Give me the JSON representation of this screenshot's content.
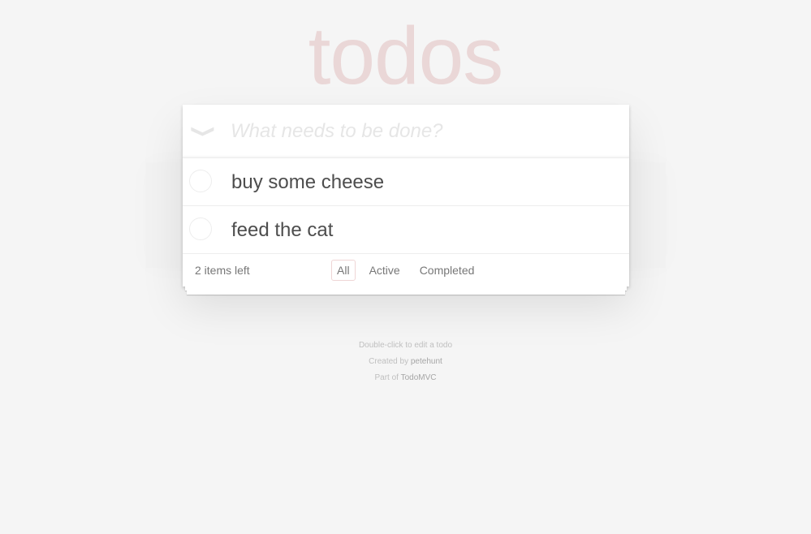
{
  "header": {
    "title": "todos",
    "toggle_all_icon": "❯",
    "new_todo_placeholder": "What needs to be done?"
  },
  "todos": [
    {
      "label": "buy some cheese",
      "completed": false
    },
    {
      "label": "feed the cat",
      "completed": false
    }
  ],
  "footer": {
    "count_text": "2 items left",
    "filters": [
      {
        "label": "All",
        "selected": true
      },
      {
        "label": "Active",
        "selected": false
      },
      {
        "label": "Completed",
        "selected": false
      }
    ]
  },
  "info": {
    "hint": "Double-click to edit a todo",
    "created_by_prefix": "Created by",
    "author": "petehunt",
    "part_of_prefix": "Part of",
    "project": "TodoMVC"
  },
  "colors": {
    "background": "#f5f5f5",
    "title": "rgba(175,47,47,0.15)",
    "selected_filter_border": "rgba(175,47,47,0.2)"
  }
}
